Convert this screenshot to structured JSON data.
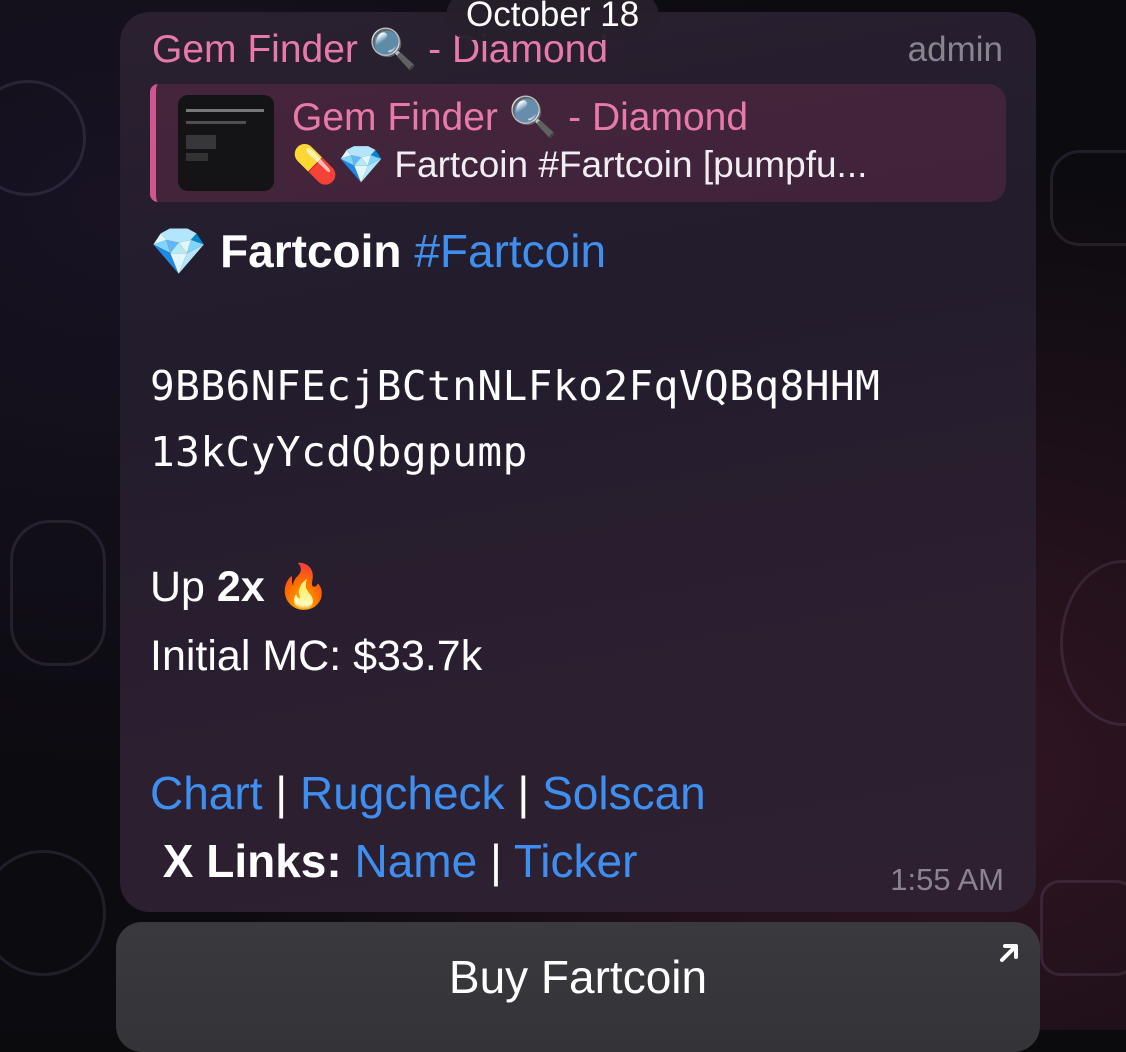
{
  "date_pill": "October 18",
  "message": {
    "sender": "Gem Finder 🔍 - Diamond",
    "role": "admin",
    "forwarded": {
      "title": "Gem Finder 🔍 - Diamond",
      "text": "💊💎 Fartcoin #Fartcoin [pumpfu..."
    },
    "title_emoji": "💎",
    "title_name": "Fartcoin",
    "title_tag": "#Fartcoin",
    "address_line1": "9BB6NFEcjBCtnNLFko2FqVQBq8HHM",
    "address_line2": "13kCyYcdQbgpump",
    "up_prefix": "Up",
    "up_value": "2x",
    "up_emoji": "🔥",
    "initial_mc": "Initial MC: $33.7k",
    "links": {
      "chart": "Chart",
      "rugcheck": "Rugcheck",
      "solscan": "Solscan",
      "separator": "|",
      "x_links_label": "X Links:",
      "name": "Name",
      "ticker": "Ticker"
    },
    "time": "1:55 AM"
  },
  "buy_button": {
    "label": "Buy Fartcoin",
    "icon": "external-arrow-icon"
  },
  "colors": {
    "accent_pink": "#e87aa8",
    "link_blue": "#3e8ff0",
    "bubble": "#251e2c"
  }
}
